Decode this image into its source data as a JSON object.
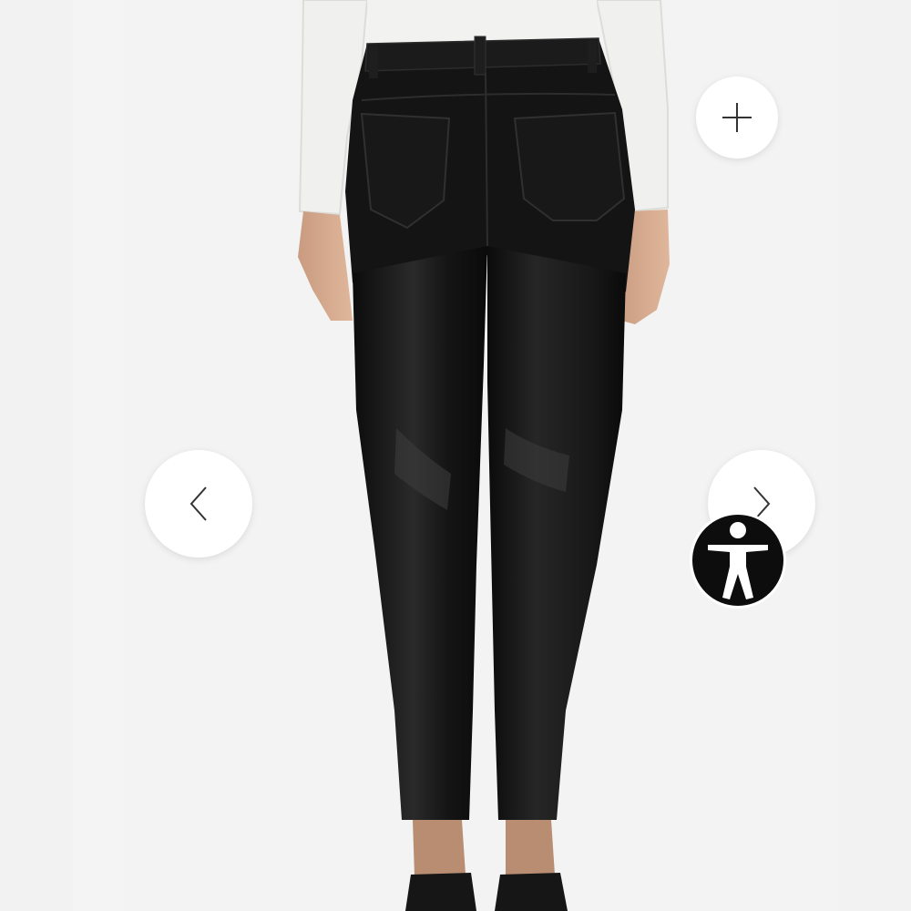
{
  "viewer": {
    "zoom_button": {
      "icon": "plus-icon"
    },
    "prev_button": {
      "icon": "chevron-left-icon"
    },
    "next_button": {
      "icon": "chevron-right-icon"
    },
    "accessibility_button": {
      "icon": "accessibility-person-icon"
    },
    "image": {
      "subject": "product-photo"
    }
  },
  "colors": {
    "background": "#f4f4f4",
    "button_bg": "#ffffff",
    "accessibility_bg": "#0d0d0d",
    "icon_stroke": "#333333"
  }
}
